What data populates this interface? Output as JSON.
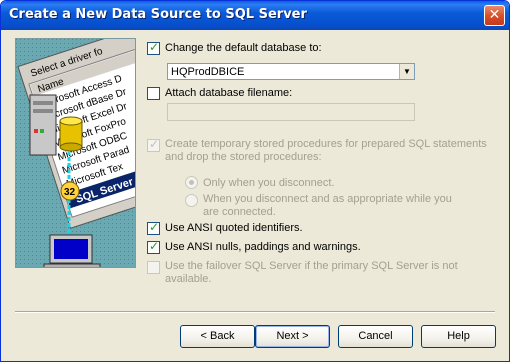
{
  "window": {
    "title": "Create a New Data Source to SQL Server"
  },
  "illustration": {
    "caption_top": "Select a driver fo",
    "column_header": "Name",
    "drivers": [
      "Microsoft Access D",
      "Microsoft dBase Dr",
      "Microsoft Excel Dr",
      "Microsoft FoxPro",
      "Microsoft ODBC",
      "Microsoft Parad",
      "Microsoft Tex"
    ],
    "highlight": "SQL Server",
    "badge": "32"
  },
  "options": {
    "change_default_db": {
      "label": "Change the default database to:",
      "checked": true
    },
    "database_value": "HQProdDBICE",
    "attach_db": {
      "label": "Attach database filename:",
      "checked": false
    },
    "attach_value": "",
    "temp_procs": {
      "label": "Create temporary stored procedures for prepared SQL statements and drop the stored procedures:",
      "checked": true,
      "enabled": false
    },
    "radio_disconnect": {
      "label": "Only when you disconnect.",
      "selected": true
    },
    "radio_appropriate": {
      "label": "When you disconnect and as appropriate while you are connected.",
      "selected": false
    },
    "ansi_quoted": {
      "label": "Use ANSI quoted identifiers.",
      "checked": true
    },
    "ansi_nulls": {
      "label": "Use ANSI nulls, paddings and warnings.",
      "checked": true
    },
    "failover": {
      "label": "Use the failover SQL Server if the primary SQL Server is not available.",
      "checked": false,
      "enabled": false
    }
  },
  "buttons": {
    "back": "< Back",
    "next": "Next >",
    "cancel": "Cancel",
    "help": "Help"
  }
}
